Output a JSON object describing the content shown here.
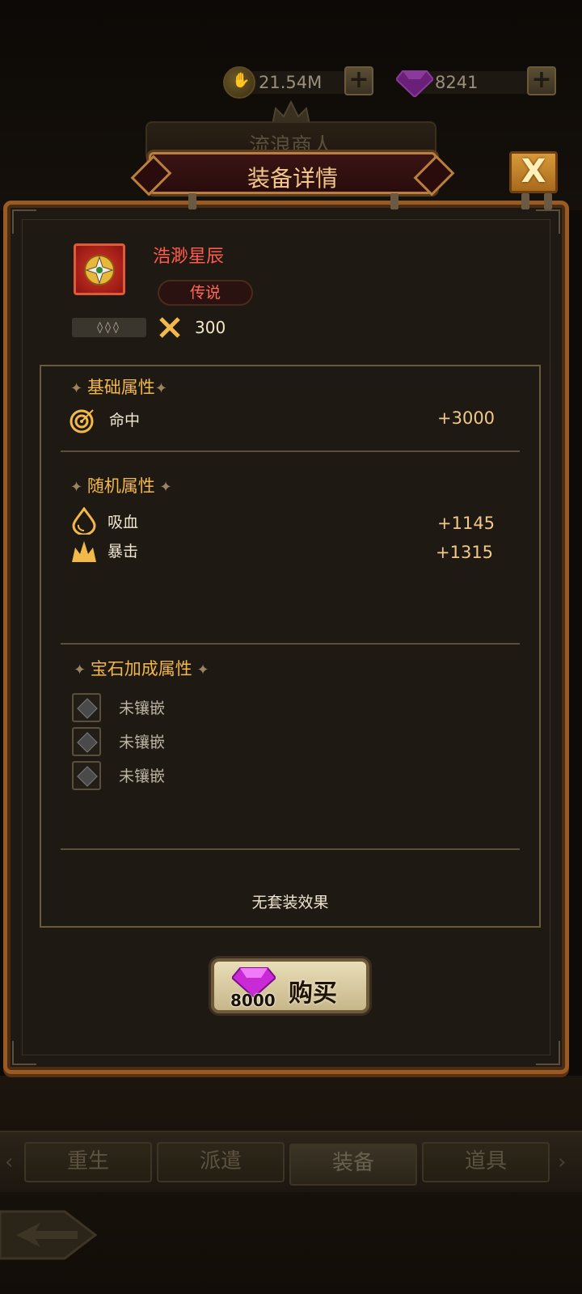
{
  "currency": {
    "gold": "21.54M",
    "gems": "8241"
  },
  "header": {
    "behind_title": "流浪商人",
    "title": "装备详情",
    "close_label": "X"
  },
  "item": {
    "name": "浩渺星辰",
    "rarity": "传说",
    "power": "300",
    "stars": "◊◊◊"
  },
  "sections": {
    "base": {
      "title": "基础属性",
      "stats": [
        {
          "name": "命中",
          "value": "+3000",
          "icon": "target-icon"
        }
      ]
    },
    "random": {
      "title": "随机属性",
      "stats": [
        {
          "name": "吸血",
          "value": "+1145",
          "icon": "blood-drop-icon"
        },
        {
          "name": "暴击",
          "value": "+1315",
          "icon": "crit-burst-icon"
        }
      ]
    },
    "gems": {
      "title": "宝石加成属性",
      "slots": [
        {
          "label": "未镶嵌"
        },
        {
          "label": "未镶嵌"
        },
        {
          "label": "未镶嵌"
        }
      ]
    },
    "set_effect": "无套装效果"
  },
  "buy": {
    "price": "8000",
    "label": "购买"
  },
  "tabs": [
    {
      "label": "重生",
      "active": false
    },
    {
      "label": "派遣",
      "active": false
    },
    {
      "label": "装备",
      "active": true
    },
    {
      "label": "道具",
      "active": false
    }
  ],
  "colors": {
    "legendary": "#ff5a4a",
    "section_title": "#f2b84a",
    "stat_value": "#f1c889",
    "panel_border": "#9a5a24"
  }
}
